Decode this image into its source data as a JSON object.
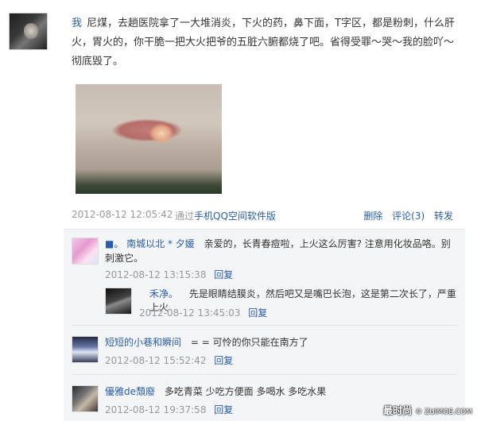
{
  "post": {
    "author": "我",
    "text": "尼煤，去趟医院拿了一大堆消炎，下火的药，鼻下面，T字区，都是粉刺，什么肝火，胃火的，你干脆一把大火把爷的五脏六腑都烧了吧。省得受罪～哭～我的脸吖～彻底毁了。",
    "time": "2012-08-12 12:05:42",
    "via_prefix": "通过",
    "via_link": "手机QQ空间软件版",
    "actions": {
      "delete": "删除",
      "comment": "评论(3)",
      "forward": "转发"
    }
  },
  "comments": [
    {
      "name": "■。 南城以北 * 夕媛",
      "text": "亲爱的，长青春痘啦，上火这么厉害? 注意用化妆品咯。别刺激它。",
      "time": "2012-08-12 13:15:38",
      "reply_label": "回复",
      "replies": [
        {
          "name": "禾净。",
          "text": "先是眼睛结膜炎，然后吧又是嘴巴长泡，这是第二次长了，严重上火",
          "time": "2012-08-12 13:45:03",
          "reply_label": "回复"
        }
      ]
    },
    {
      "name": "短短的小巷和瞬间",
      "text": "= = 可怜的你只能在南方了",
      "time": "2012-08-12 15:52:42",
      "reply_label": "回复"
    },
    {
      "name": "優雅de頹廢",
      "text": "多吃青菜 少吃方便面 多喝水 多吃水果",
      "time": "2012-08-12 19:37:58",
      "reply_label": "回复"
    }
  ],
  "watermark": {
    "main": "最时尚",
    "sub": "© ZUIMOE.COM"
  }
}
